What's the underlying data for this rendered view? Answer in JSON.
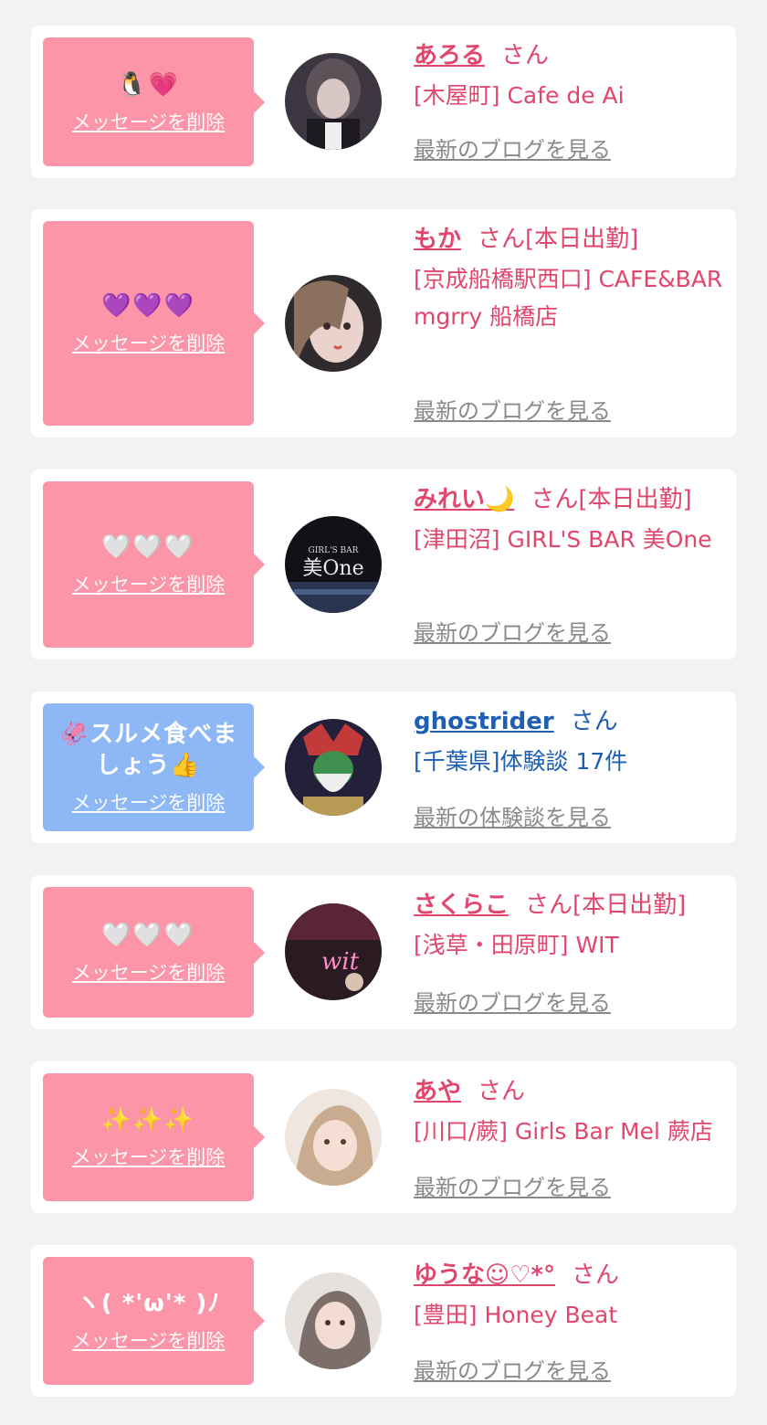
{
  "common": {
    "delete_label": "メッセージを削除",
    "san": "さん"
  },
  "colors": {
    "pink_bubble": "#fb95a7",
    "blue_bubble": "#8db8f5",
    "name_pink": "#e2466e",
    "name_blue": "#1e5fb3",
    "link_gray": "#8a8a8a",
    "background": "#f2f2f2"
  },
  "cards": [
    {
      "message": "🐧💗",
      "name": "あろる",
      "status": "",
      "store": "[木屋町] Cafe de Ai",
      "link": "最新のブログを見る",
      "avatar_icon": "avatar-photo"
    },
    {
      "message": "💜💜💜",
      "name": "もか",
      "status": "[本日出勤]",
      "store": "[京成船橋駅西口] CAFE&BAR mgrry 船橋店",
      "link": "最新のブログを見る",
      "avatar_icon": "avatar-photo"
    },
    {
      "message": "🤍🤍🤍",
      "name": "みれい🌙",
      "status": "[本日出勤]",
      "store": "[津田沼] GIRL'S BAR 美One",
      "link": "最新のブログを見る",
      "avatar_icon": "avatar-logo"
    },
    {
      "message": "🦑スルメ食べましょう👍",
      "name": "ghostrider",
      "status": "",
      "store": "[千葉県]体験談 17件",
      "link": "最新の体験談を見る",
      "avatar_icon": "avatar-illustration"
    },
    {
      "message": "🤍🤍🤍",
      "name": "さくらこ",
      "status": "[本日出勤]",
      "store": "[浅草・田原町] WIT",
      "link": "最新のブログを見る",
      "avatar_icon": "avatar-neon"
    },
    {
      "message": "✨✨✨",
      "name": "あや",
      "status": "",
      "store": "[川口/蕨] Girls Bar Mel 蕨店",
      "link": "最新のブログを見る",
      "avatar_icon": "avatar-photo"
    },
    {
      "message": "ヽ( *'ω'* )ﾉ",
      "name": "ゆうな☺︎♡*°",
      "status": "",
      "store": "[豊田] Honey Beat",
      "link": "最新のブログを見る",
      "avatar_icon": "avatar-photo"
    }
  ]
}
